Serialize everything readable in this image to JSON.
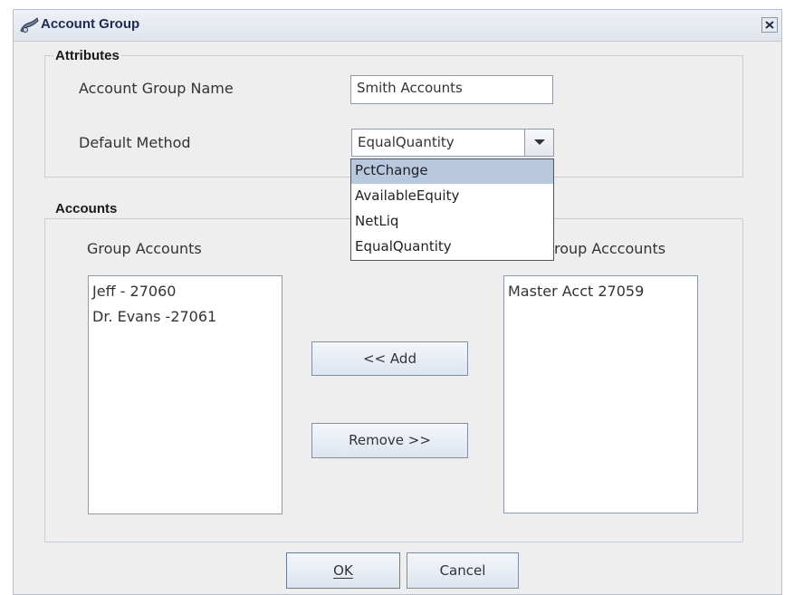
{
  "window": {
    "title": "Account Group",
    "icon": "account-group-icon",
    "close_icon": "close-icon"
  },
  "attributes": {
    "group_title": "Attributes",
    "name_label": "Account Group Name",
    "name_value": "Smith Accounts",
    "method_label": "Default Method",
    "method_value": "EqualQuantity",
    "method_options": [
      "PctChange",
      "AvailableEquity",
      "NetLiq",
      "EqualQuantity"
    ],
    "highlighted_option": "PctChange"
  },
  "accounts": {
    "group_title": "Accounts",
    "group_accounts_label": "Group Accounts",
    "other_accounts_label": "roup Acccounts",
    "group_accounts": [
      "Jeff - 27060",
      "Dr. Evans -27061"
    ],
    "other_accounts": [
      "Master Acct 27059"
    ],
    "add_label": "<< Add",
    "remove_label": "Remove >>"
  },
  "footer": {
    "ok_label": "OK",
    "cancel_label": "Cancel"
  },
  "colors": {
    "titlebar": "#dfe4ec",
    "dialog_bg": "#eeeeee",
    "highlight": "#b8c8de",
    "button_border": "#7f8fa6"
  }
}
